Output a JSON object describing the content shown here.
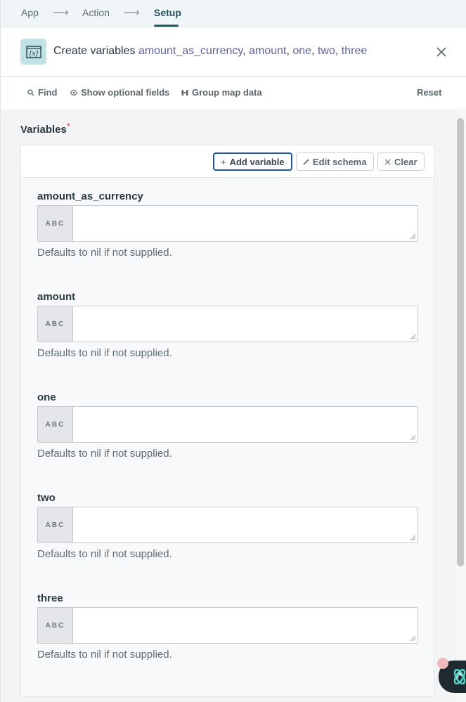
{
  "breadcrumb": {
    "items": [
      {
        "label": "App",
        "active": false
      },
      {
        "label": "Action",
        "active": false
      },
      {
        "label": "Setup",
        "active": true
      }
    ],
    "separator_icon": "arrow-right-icon"
  },
  "header": {
    "app_icon": "variable-window-icon",
    "title_prefix": "Create variables",
    "variables": [
      "amount_as_currency",
      "amount",
      "one",
      "two",
      "three"
    ],
    "separator": ",",
    "close_icon": "close-icon"
  },
  "toolbar": {
    "find_label": "Find",
    "find_icon": "search-icon",
    "show_optional_label": "Show optional fields",
    "show_optional_icon": "eye-icon",
    "group_map_label": "Group map data",
    "group_map_icon": "group-icon",
    "reset_label": "Reset"
  },
  "variables_section": {
    "label": "Variables",
    "required_mark": "*",
    "buttons": {
      "add_variable": "Add variable",
      "edit_schema": "Edit schema",
      "clear": "Clear"
    },
    "fields": [
      {
        "name": "amount_as_currency",
        "type_chip": "ABC",
        "value": "",
        "hint": "Defaults to nil if not supplied."
      },
      {
        "name": "amount",
        "type_chip": "ABC",
        "value": "",
        "hint": "Defaults to nil if not supplied."
      },
      {
        "name": "one",
        "type_chip": "ABC",
        "value": "",
        "hint": "Defaults to nil if not supplied."
      },
      {
        "name": "two",
        "type_chip": "ABC",
        "value": "",
        "hint": "Defaults to nil if not supplied."
      },
      {
        "name": "three",
        "type_chip": "ABC",
        "value": "",
        "hint": "Defaults to nil if not supplied."
      }
    ]
  },
  "colors": {
    "accent": "#1d5c66",
    "variable_text": "#5e6396",
    "primary_button_border": "#1f55a3",
    "required": "#d33a3a"
  },
  "assistant": {
    "icon": "atom-assistant-icon"
  }
}
